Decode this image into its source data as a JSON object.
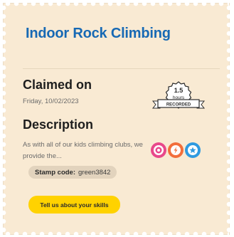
{
  "card": {
    "title": "Indoor Rock Climbing",
    "claimed_heading": "Claimed on",
    "claimed_date": "Friday, 10/02/2023",
    "description_heading": "Description",
    "description_text": "As with all of our kids climbing clubs, we provide the...",
    "stamp_code_label": "Stamp code:",
    "stamp_code_value": "green3842",
    "cta_label": "Tell us about your skills"
  },
  "badge": {
    "hours_value": "1.5",
    "hours_unit": "hours",
    "ribbon_label": "RECORDED"
  },
  "skills": [
    {
      "icon": "target-icon",
      "color": "#e8488a"
    },
    {
      "icon": "lightning-icon",
      "color": "#f26e3b"
    },
    {
      "icon": "star-icon",
      "color": "#2f9ae0"
    }
  ],
  "colors": {
    "card_background": "#f9ead3",
    "title": "#1769b4",
    "button": "#ffd200"
  }
}
